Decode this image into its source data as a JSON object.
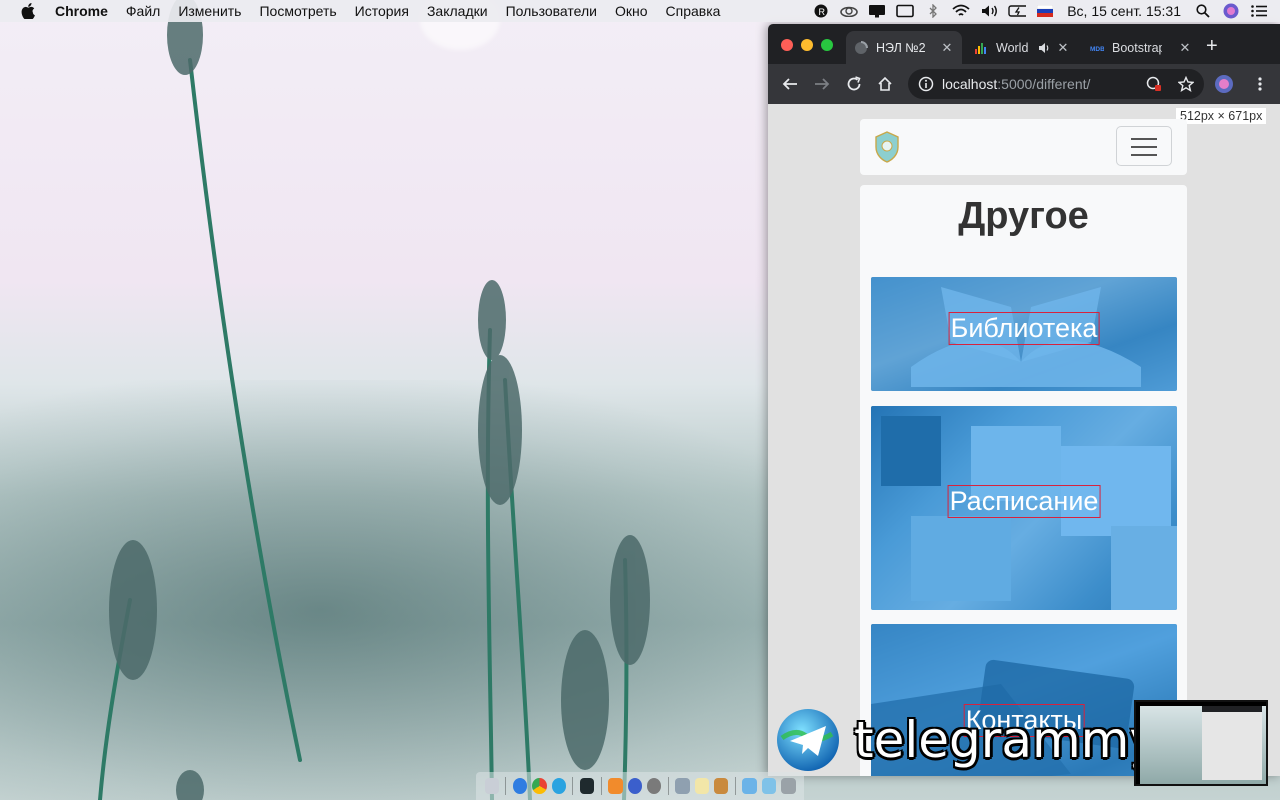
{
  "menubar": {
    "app_name": "Chrome",
    "items": [
      "Файл",
      "Изменить",
      "Посмотреть",
      "История",
      "Закладки",
      "Пользователи",
      "Окно",
      "Справка"
    ],
    "clock": "Вс, 15 сент.  15:31"
  },
  "browser": {
    "tabs": [
      {
        "title": "НЭЛ №2"
      },
      {
        "title": "World"
      },
      {
        "title": "Bootstrap"
      }
    ],
    "url": {
      "host": "localhost",
      "rest": ":5000/different/"
    },
    "viewport_size_label": "512px × 671px"
  },
  "page": {
    "title": "Другое",
    "cards": [
      {
        "label": "Библиотека"
      },
      {
        "label": "Расписание"
      },
      {
        "label": "Контакты"
      }
    ]
  },
  "watermark": {
    "text": "telegrammy.net"
  },
  "colors": {
    "card_overlay": "#2196f3",
    "label_border": "#d8223d",
    "titlebar": "#202124",
    "toolbar": "#35363a"
  }
}
